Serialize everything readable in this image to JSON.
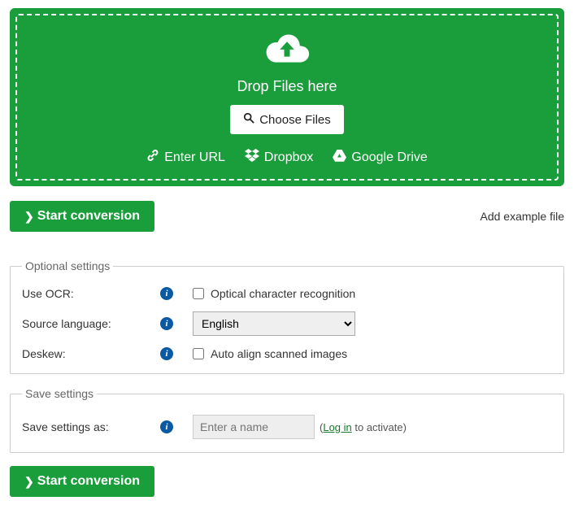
{
  "drop": {
    "text": "Drop Files here",
    "choose": "Choose Files",
    "url": "Enter URL",
    "dropbox": "Dropbox",
    "gdrive": "Google Drive"
  },
  "start_label": "Start conversion",
  "example": "Add example file",
  "optional": {
    "legend": "Optional settings",
    "ocr_label": "Use OCR:",
    "ocr_text": "Optical character recognition",
    "lang_label": "Source language:",
    "lang_value": "English",
    "deskew_label": "Deskew:",
    "deskew_text": "Auto align scanned images"
  },
  "save": {
    "legend": "Save settings",
    "label": "Save settings as:",
    "placeholder": "Enter a name",
    "login": "Log in",
    "hint_suffix": " to activate)"
  }
}
